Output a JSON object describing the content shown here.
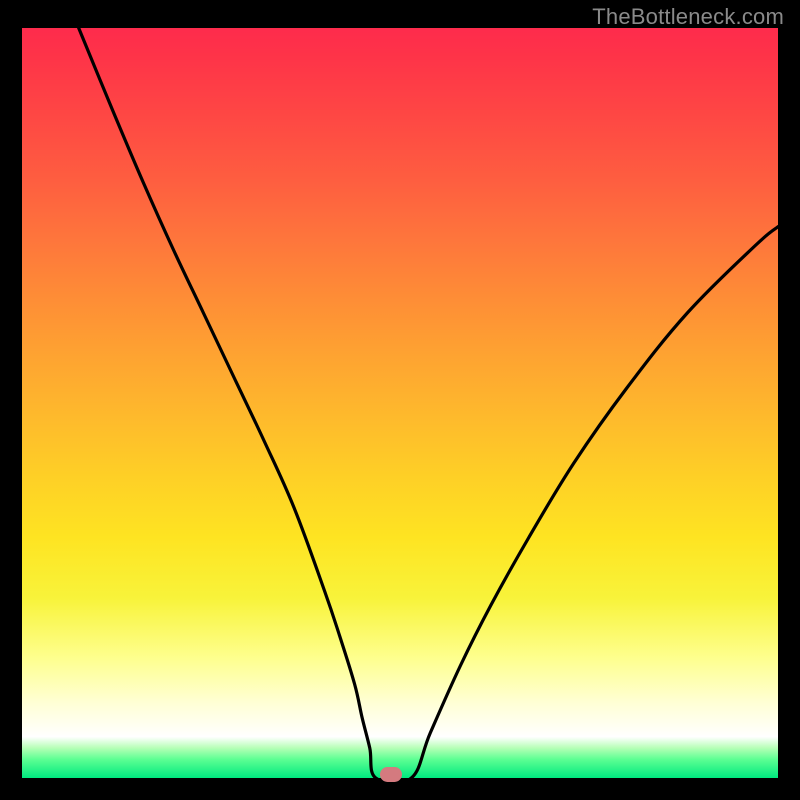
{
  "watermark": "TheBottleneck.com",
  "chart_data": {
    "type": "line",
    "title": "",
    "xlabel": "",
    "ylabel": "",
    "xlim": [
      0,
      100
    ],
    "ylim": [
      0,
      100
    ],
    "grid": false,
    "legend": false,
    "series": [
      {
        "name": "curve",
        "color": "#000000",
        "x": [
          7.5,
          12,
          16,
          20,
          24,
          28,
          32,
          36,
          40,
          42,
          44,
          45,
          46,
          46.8,
          51.5,
          54,
          58,
          62,
          67,
          73,
          80,
          88,
          97,
          100
        ],
        "y": [
          100,
          89,
          79.5,
          70.5,
          62,
          53.5,
          45,
          36,
          25,
          19,
          12.5,
          8,
          4,
          0,
          0,
          6,
          15,
          23,
          32,
          42,
          52,
          62,
          71,
          73.5
        ]
      }
    ],
    "marker": {
      "x": 48.8,
      "y": 0.4,
      "color": "#d47a7f"
    }
  }
}
